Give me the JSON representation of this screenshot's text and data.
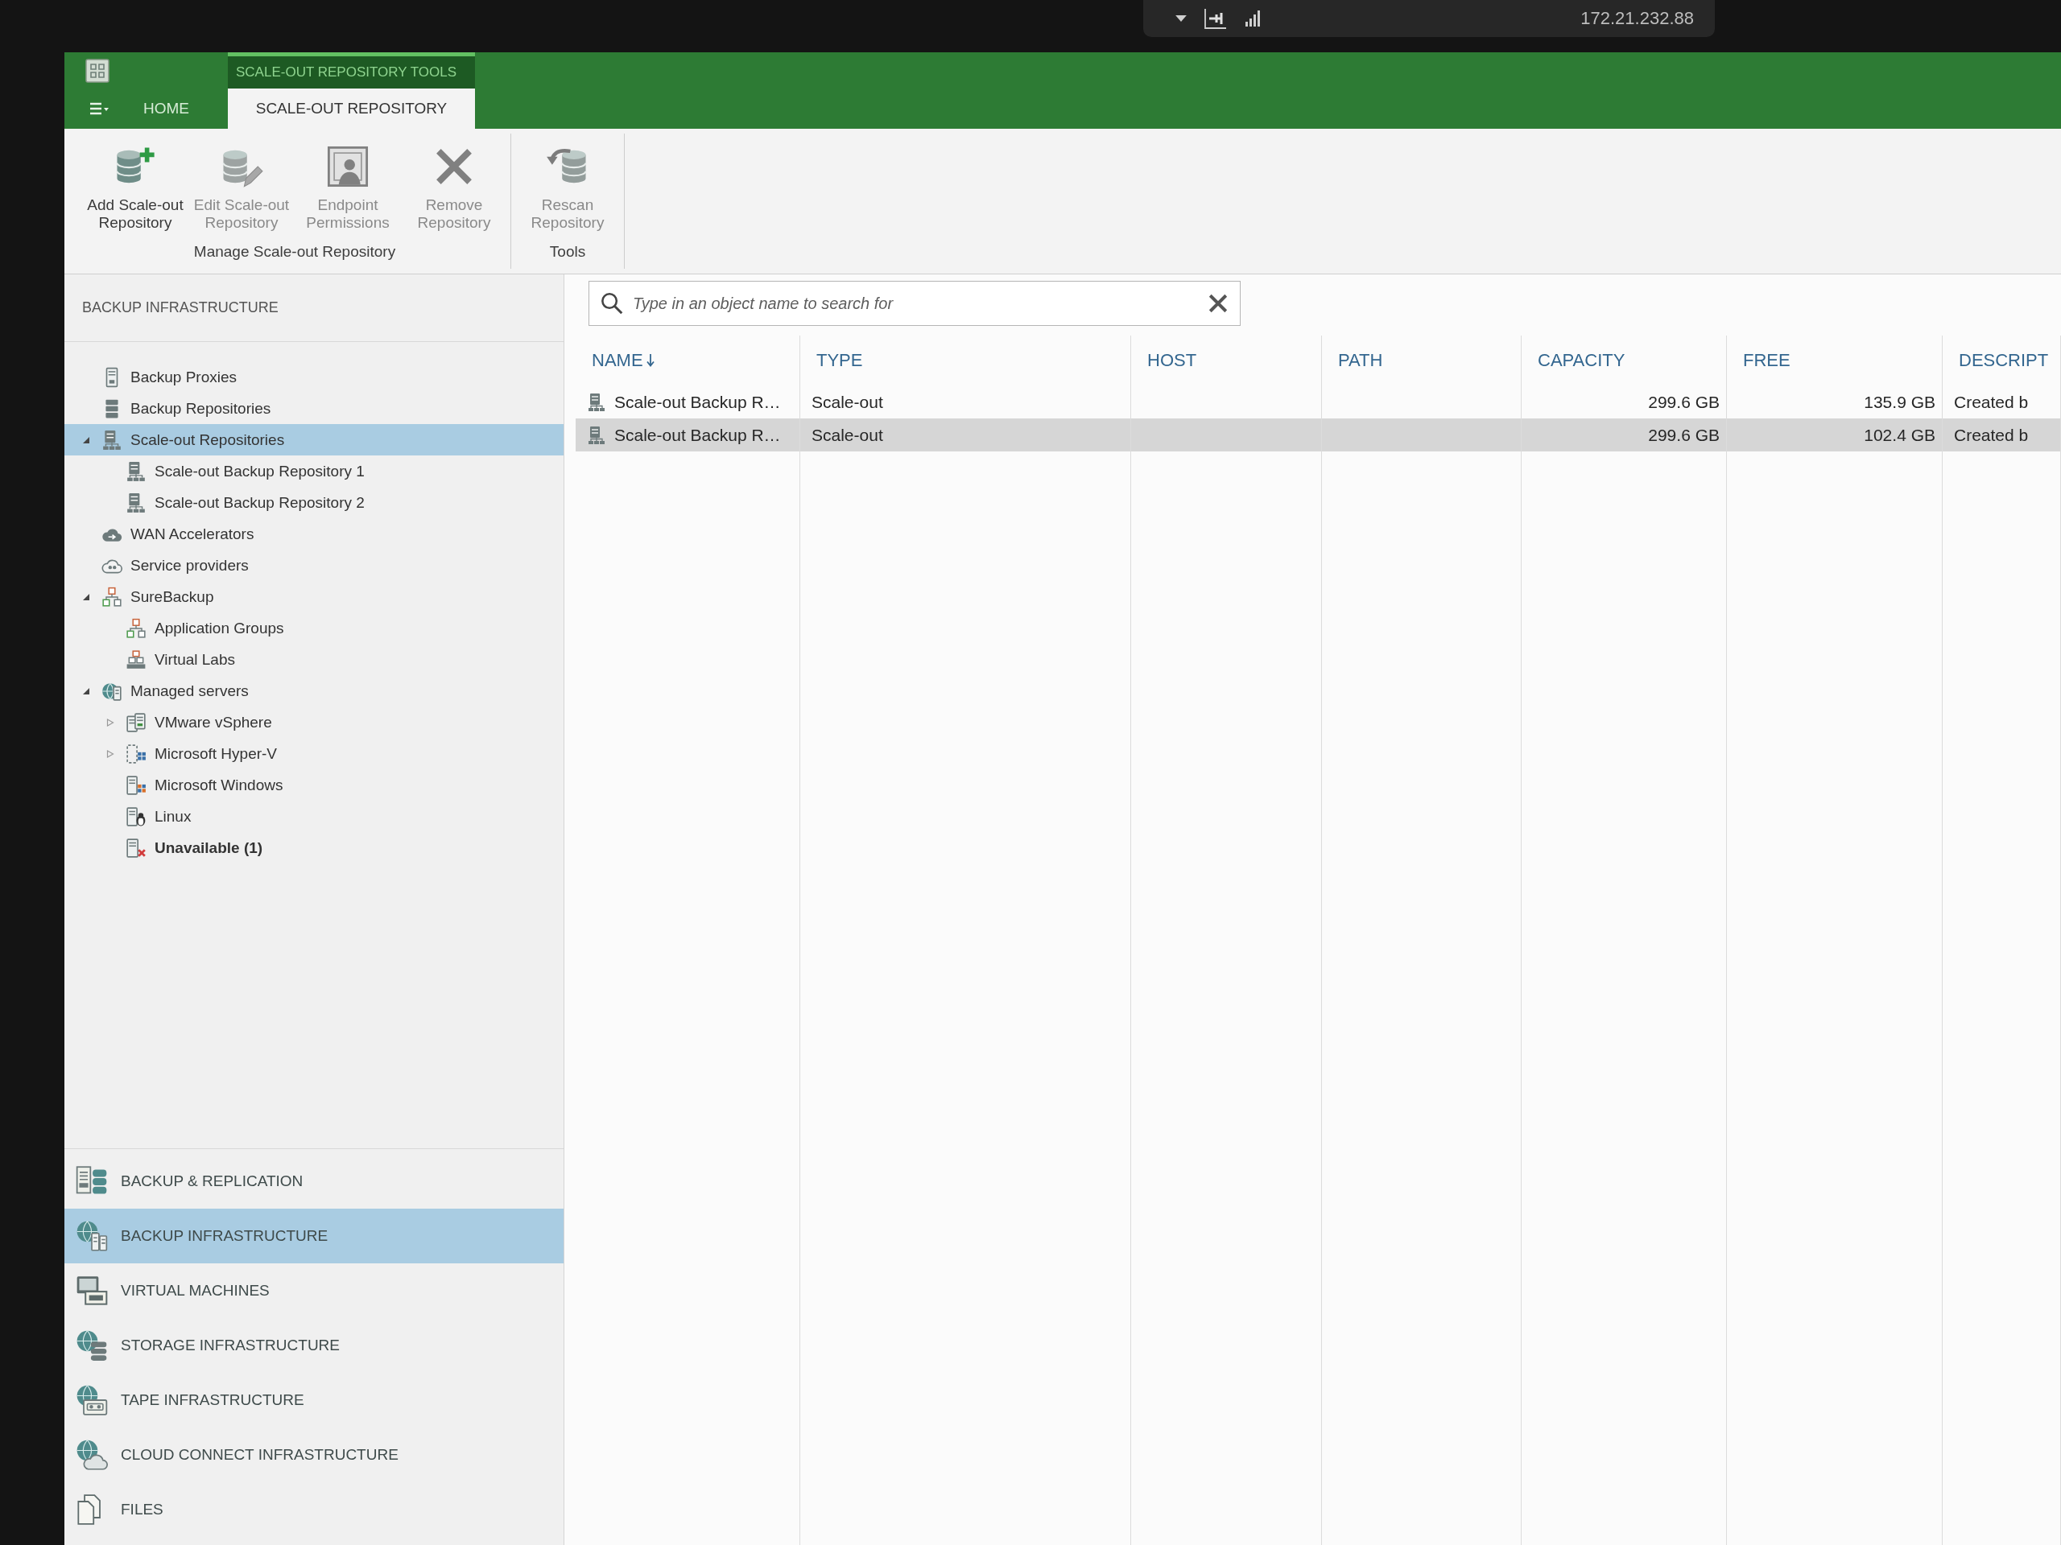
{
  "connection_bar": {
    "address": "172.21.232.88"
  },
  "ribbon": {
    "context_group": "SCALE-OUT REPOSITORY TOOLS",
    "tabs": [
      {
        "label": "HOME",
        "selected": false,
        "contextual": false
      },
      {
        "label": "SCALE-OUT REPOSITORY",
        "selected": true,
        "contextual": true
      }
    ],
    "groups": [
      {
        "label": "Manage Scale-out Repository",
        "buttons": [
          {
            "label": "Add Scale-out Repository",
            "kind": "add",
            "disabled": false
          },
          {
            "label": "Edit Scale-out Repository",
            "kind": "edit",
            "disabled": true
          },
          {
            "label": "Endpoint Permissions",
            "kind": "permissions",
            "disabled": true
          },
          {
            "label": "Remove Repository",
            "kind": "remove",
            "disabled": true
          }
        ]
      },
      {
        "label": "Tools",
        "buttons": [
          {
            "label": "Rescan Repository",
            "kind": "rescan",
            "disabled": true
          }
        ]
      }
    ]
  },
  "navigation_pane": {
    "title": "BACKUP INFRASTRUCTURE",
    "tree": [
      {
        "label": "Backup Proxies",
        "kind": "proxy",
        "selected": false
      },
      {
        "label": "Backup Repositories",
        "kind": "repository",
        "selected": false
      },
      {
        "label": "Scale-out Repositories",
        "kind": "scaleout",
        "selected": true,
        "expanded": true,
        "children": [
          {
            "label": "Scale-out Backup Repository 1",
            "kind": "scaleout",
            "selected": false
          },
          {
            "label": "Scale-out Backup Repository 2",
            "kind": "scaleout",
            "selected": false
          }
        ]
      },
      {
        "label": "WAN Accelerators",
        "kind": "wan",
        "selected": false
      },
      {
        "label": "Service providers",
        "kind": "provider",
        "selected": false
      },
      {
        "label": "SureBackup",
        "kind": "surebackup",
        "selected": false,
        "expanded": true,
        "children": [
          {
            "label": "Application Groups",
            "kind": "surebackup",
            "selected": false
          },
          {
            "label": "Virtual Labs",
            "kind": "lab",
            "selected": false
          }
        ]
      },
      {
        "label": "Managed servers",
        "kind": "managed",
        "selected": false,
        "expanded": true,
        "children": [
          {
            "label": "VMware vSphere",
            "kind": "vsphere",
            "selected": false,
            "expanded": false
          },
          {
            "label": "Microsoft Hyper-V",
            "kind": "hyperv",
            "selected": false,
            "expanded": false
          },
          {
            "label": "Microsoft Windows",
            "kind": "windows",
            "selected": false
          },
          {
            "label": "Linux",
            "kind": "linux",
            "selected": false
          },
          {
            "label": "Unavailable (1)",
            "kind": "unavailable",
            "selected": false
          }
        ]
      }
    ],
    "sections": [
      {
        "label": "BACKUP & REPLICATION",
        "kind": "backup",
        "selected": false
      },
      {
        "label": "BACKUP INFRASTRUCTURE",
        "kind": "infrastructure",
        "selected": true
      },
      {
        "label": "VIRTUAL MACHINES",
        "kind": "vm",
        "selected": false
      },
      {
        "label": "STORAGE INFRASTRUCTURE",
        "kind": "storage",
        "selected": false
      },
      {
        "label": "TAPE INFRASTRUCTURE",
        "kind": "tape",
        "selected": false
      },
      {
        "label": "CLOUD CONNECT INFRASTRUCTURE",
        "kind": "cloud",
        "selected": false
      },
      {
        "label": "FILES",
        "kind": "files",
        "selected": false
      }
    ]
  },
  "search": {
    "placeholder": "Type in an object name to search for"
  },
  "table": {
    "columns": [
      {
        "label": "NAME",
        "sorted": true
      },
      {
        "label": "TYPE",
        "sorted": false
      },
      {
        "label": "HOST",
        "sorted": false
      },
      {
        "label": "PATH",
        "sorted": false
      },
      {
        "label": "CAPACITY",
        "sorted": false
      },
      {
        "label": "FREE",
        "sorted": false
      },
      {
        "label": "DESCRIPT",
        "sorted": false
      }
    ],
    "rows": [
      {
        "name": "Scale-out Backup R…",
        "type": "Scale-out",
        "capacity": "299.6 GB",
        "free": "135.9 GB",
        "column_7": "Created b",
        "selected": false
      },
      {
        "name": "Scale-out Backup R…",
        "type": "Scale-out",
        "capacity": "299.6 GB",
        "free": "102.4 GB",
        "column_7": "Created b",
        "selected": true
      }
    ]
  }
}
